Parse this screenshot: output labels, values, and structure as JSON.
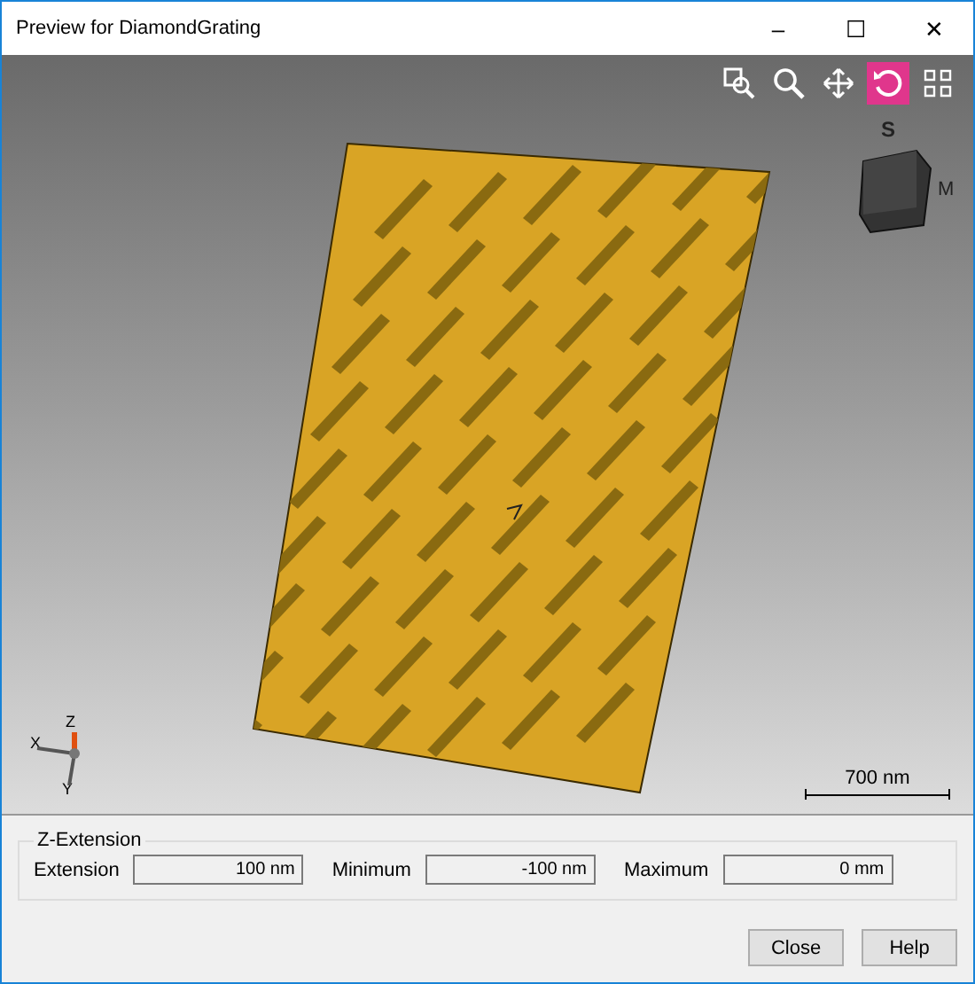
{
  "window": {
    "title": "Preview for DiamondGrating",
    "controls": [
      "–",
      "☐",
      "✕"
    ]
  },
  "toolbar": [
    {
      "kind": "zoom-box",
      "selected": false
    },
    {
      "kind": "zoom",
      "selected": false
    },
    {
      "kind": "pan",
      "selected": false
    },
    {
      "kind": "rotate",
      "selected": true
    },
    {
      "kind": "fit",
      "selected": false
    }
  ],
  "nav_cube": {
    "labels": [
      "S",
      "M"
    ]
  },
  "axes": {
    "labels": [
      "Z",
      "X",
      "Y"
    ]
  },
  "scale_bar": {
    "label": "700 nm"
  },
  "z_extension": {
    "title": "Z-Extension",
    "fields": [
      {
        "label": "Extension",
        "value": "100 nm"
      },
      {
        "label": "Minimum",
        "value": "-100 nm"
      },
      {
        "label": "Maximum",
        "value": "0 mm"
      }
    ]
  },
  "buttons": [
    "Close",
    "Help"
  ]
}
